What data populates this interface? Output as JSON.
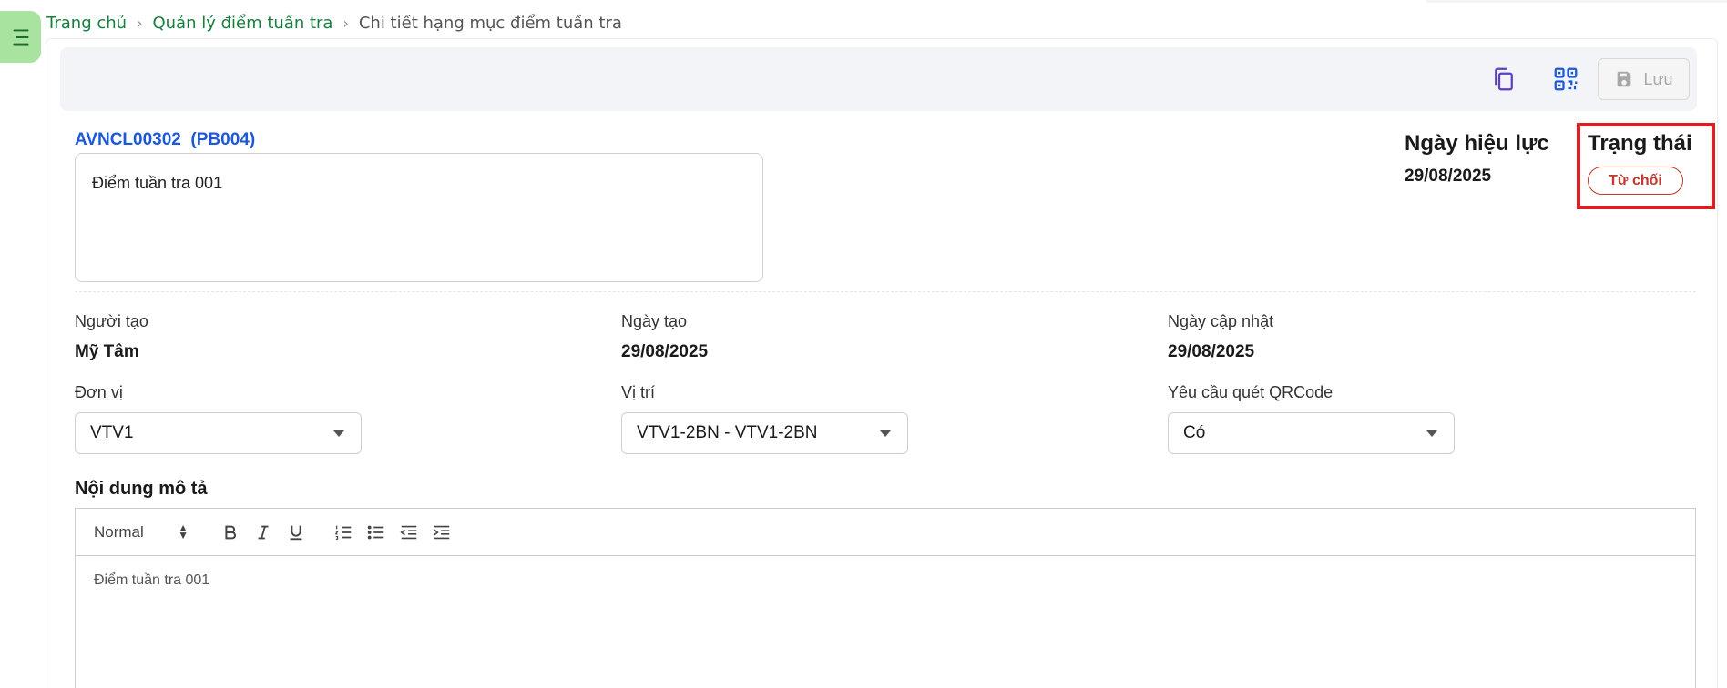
{
  "breadcrumb": {
    "home": "Trang chủ",
    "parent": "Quản lý điểm tuần tra",
    "current": "Chi tiết hạng mục điểm tuần tra"
  },
  "toolbar": {
    "save_label": "Lưu",
    "icons": [
      "copy-icon",
      "qr-code-icon",
      "save-icon"
    ]
  },
  "record": {
    "code": "AVNCL00302  (PB004)",
    "name": "Điểm tuần tra 001"
  },
  "effective": {
    "label": "Ngày hiệu lực",
    "date": "29/08/2025"
  },
  "status": {
    "label": "Trạng thái",
    "value": "Từ chối",
    "color": "#c0392b",
    "highlight_color": "#e11d24"
  },
  "fields": {
    "creator": {
      "label": "Người tạo",
      "value": "Mỹ Tâm"
    },
    "created": {
      "label": "Ngày tạo",
      "value": "29/08/2025"
    },
    "updated": {
      "label": "Ngày cập nhật",
      "value": "29/08/2025"
    },
    "unit": {
      "label": "Đơn vị",
      "value": "VTV1"
    },
    "location": {
      "label": "Vị trí",
      "value": "VTV1-2BN - VTV1-2BN"
    },
    "qr_required": {
      "label": "Yêu cầu quét QRCode",
      "value": "Có"
    }
  },
  "description": {
    "label": "Nội dung mô tả",
    "heading_option": "Normal",
    "content": "Điểm tuần tra 001"
  },
  "colors": {
    "accent_green": "#15803d",
    "menu_bg": "#a8e3a0",
    "link_blue": "#1d59d6"
  }
}
